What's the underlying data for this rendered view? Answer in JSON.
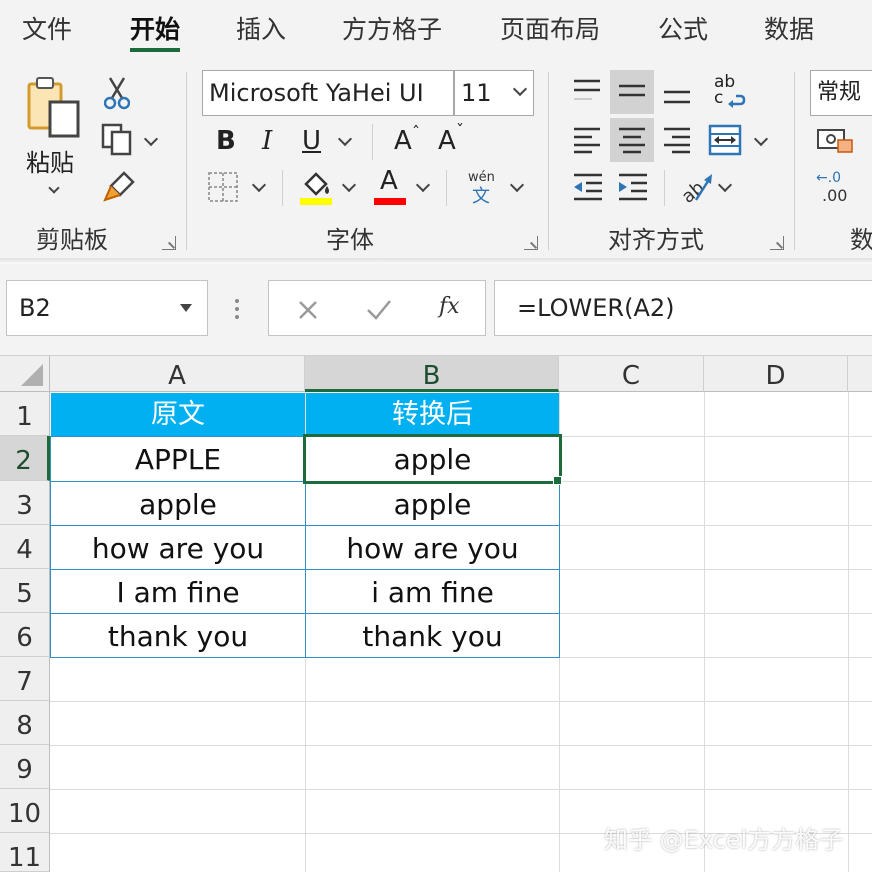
{
  "ribbon_tabs": [
    "文件",
    "开始",
    "插入",
    "方方格子",
    "页面布局",
    "公式",
    "数据"
  ],
  "active_tab": "开始",
  "clipboard": {
    "paste_label": "粘贴",
    "group_label": "剪贴板"
  },
  "font": {
    "name": "Microsoft YaHei UI",
    "size": "11",
    "group_label": "字体",
    "bold": "B",
    "italic": "I",
    "underline": "U",
    "grow": "A",
    "shrink": "A",
    "font_color_letter": "A",
    "fill_color": "#ffff00",
    "font_color": "#ff0000",
    "phonetic_top": "wén",
    "phonetic_bottom": "文"
  },
  "alignment": {
    "group_label": "对齐方式",
    "wrap_top": "ab",
    "wrap_bottom": "c"
  },
  "number": {
    "format": "常规",
    "group_label_partial": "数",
    "decimal_top": "←.0",
    "decimal_bottom": ".00"
  },
  "formula_bar": {
    "name_box": "B2",
    "formula": "=LOWER(A2)",
    "fx": "fx"
  },
  "grid": {
    "columns": [
      "A",
      "B",
      "C",
      "D"
    ],
    "selected_column": "B",
    "rows": [
      "1",
      "2",
      "3",
      "4",
      "5",
      "6",
      "7",
      "8",
      "9",
      "10",
      "11"
    ],
    "selected_row": "2",
    "header": [
      "原文",
      "转换后"
    ],
    "data": [
      [
        "APPLE",
        "apple"
      ],
      [
        "apple",
        "apple"
      ],
      [
        "how are you",
        "how are you"
      ],
      [
        "I am fine",
        "i am fine"
      ],
      [
        "thank you",
        "thank you"
      ]
    ],
    "header_color": "#00b0f0",
    "selection_color": "#1d6b3c"
  },
  "watermark": "知乎 @Excel方方格子"
}
